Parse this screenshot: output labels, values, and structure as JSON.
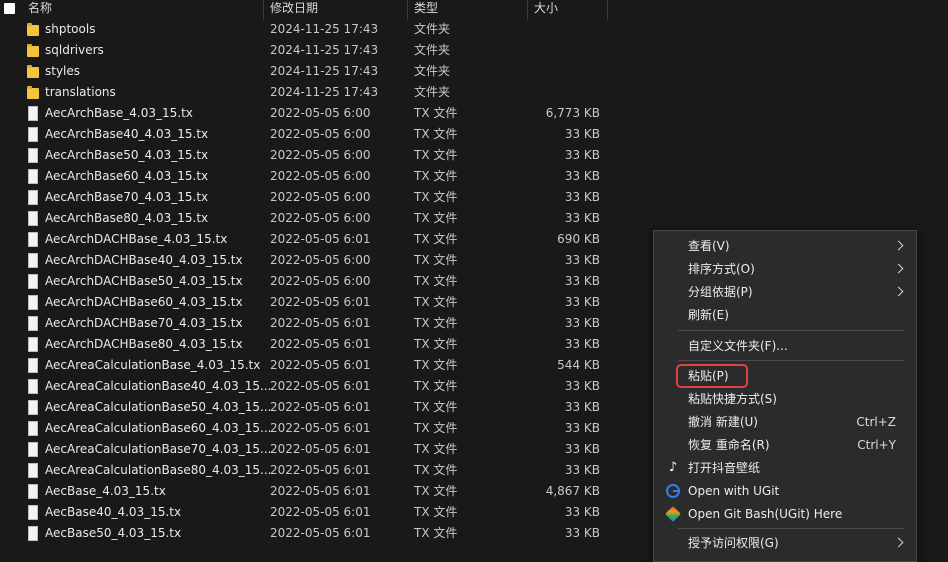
{
  "header": {
    "name_col": "名称",
    "date_col": "修改日期",
    "type_col": "类型",
    "size_col": "大小"
  },
  "rows": [
    {
      "name": "shptools",
      "date": "2024-11-25 17:43",
      "type": "文件夹",
      "size": "",
      "icon": "folder-icon"
    },
    {
      "name": "sqldrivers",
      "date": "2024-11-25 17:43",
      "type": "文件夹",
      "size": "",
      "icon": "folder-icon"
    },
    {
      "name": "styles",
      "date": "2024-11-25 17:43",
      "type": "文件夹",
      "size": "",
      "icon": "folder-icon"
    },
    {
      "name": "translations",
      "date": "2024-11-25 17:43",
      "type": "文件夹",
      "size": "",
      "icon": "folder-icon"
    },
    {
      "name": "AecArchBase_4.03_15.tx",
      "date": "2022-05-05 6:00",
      "type": "TX 文件",
      "size": "6,773 KB",
      "icon": "file-icon"
    },
    {
      "name": "AecArchBase40_4.03_15.tx",
      "date": "2022-05-05 6:00",
      "type": "TX 文件",
      "size": "33 KB",
      "icon": "file-icon"
    },
    {
      "name": "AecArchBase50_4.03_15.tx",
      "date": "2022-05-05 6:00",
      "type": "TX 文件",
      "size": "33 KB",
      "icon": "file-icon"
    },
    {
      "name": "AecArchBase60_4.03_15.tx",
      "date": "2022-05-05 6:00",
      "type": "TX 文件",
      "size": "33 KB",
      "icon": "file-icon"
    },
    {
      "name": "AecArchBase70_4.03_15.tx",
      "date": "2022-05-05 6:00",
      "type": "TX 文件",
      "size": "33 KB",
      "icon": "file-icon"
    },
    {
      "name": "AecArchBase80_4.03_15.tx",
      "date": "2022-05-05 6:00",
      "type": "TX 文件",
      "size": "33 KB",
      "icon": "file-icon"
    },
    {
      "name": "AecArchDACHBase_4.03_15.tx",
      "date": "2022-05-05 6:01",
      "type": "TX 文件",
      "size": "690 KB",
      "icon": "file-icon"
    },
    {
      "name": "AecArchDACHBase40_4.03_15.tx",
      "date": "2022-05-05 6:00",
      "type": "TX 文件",
      "size": "33 KB",
      "icon": "file-icon"
    },
    {
      "name": "AecArchDACHBase50_4.03_15.tx",
      "date": "2022-05-05 6:00",
      "type": "TX 文件",
      "size": "33 KB",
      "icon": "file-icon"
    },
    {
      "name": "AecArchDACHBase60_4.03_15.tx",
      "date": "2022-05-05 6:01",
      "type": "TX 文件",
      "size": "33 KB",
      "icon": "file-icon"
    },
    {
      "name": "AecArchDACHBase70_4.03_15.tx",
      "date": "2022-05-05 6:01",
      "type": "TX 文件",
      "size": "33 KB",
      "icon": "file-icon"
    },
    {
      "name": "AecArchDACHBase80_4.03_15.tx",
      "date": "2022-05-05 6:01",
      "type": "TX 文件",
      "size": "33 KB",
      "icon": "file-icon"
    },
    {
      "name": "AecAreaCalculationBase_4.03_15.tx",
      "date": "2022-05-05 6:01",
      "type": "TX 文件",
      "size": "544 KB",
      "icon": "file-icon"
    },
    {
      "name": "AecAreaCalculationBase40_4.03_15...",
      "date": "2022-05-05 6:01",
      "type": "TX 文件",
      "size": "33 KB",
      "icon": "file-icon"
    },
    {
      "name": "AecAreaCalculationBase50_4.03_15...",
      "date": "2022-05-05 6:01",
      "type": "TX 文件",
      "size": "33 KB",
      "icon": "file-icon"
    },
    {
      "name": "AecAreaCalculationBase60_4.03_15...",
      "date": "2022-05-05 6:01",
      "type": "TX 文件",
      "size": "33 KB",
      "icon": "file-icon"
    },
    {
      "name": "AecAreaCalculationBase70_4.03_15...",
      "date": "2022-05-05 6:01",
      "type": "TX 文件",
      "size": "33 KB",
      "icon": "file-icon"
    },
    {
      "name": "AecAreaCalculationBase80_4.03_15...",
      "date": "2022-05-05 6:01",
      "type": "TX 文件",
      "size": "33 KB",
      "icon": "file-icon"
    },
    {
      "name": "AecBase_4.03_15.tx",
      "date": "2022-05-05 6:01",
      "type": "TX 文件",
      "size": "4,867 KB",
      "icon": "file-icon"
    },
    {
      "name": "AecBase40_4.03_15.tx",
      "date": "2022-05-05 6:01",
      "type": "TX 文件",
      "size": "33 KB",
      "icon": "file-icon"
    },
    {
      "name": "AecBase50_4.03_15.tx",
      "date": "2022-05-05 6:01",
      "type": "TX 文件",
      "size": "33 KB",
      "icon": "file-icon"
    }
  ],
  "context_menu": {
    "items": [
      {
        "label": "查看(V)",
        "shortcut": "",
        "submenu": true,
        "icon": ""
      },
      {
        "label": "排序方式(O)",
        "shortcut": "",
        "submenu": true,
        "icon": ""
      },
      {
        "label": "分组依据(P)",
        "shortcut": "",
        "submenu": true,
        "icon": ""
      },
      {
        "label": "刷新(E)",
        "shortcut": "",
        "submenu": false,
        "icon": ""
      },
      {
        "label": "自定义文件夹(F)...",
        "shortcut": "",
        "submenu": false,
        "icon": ""
      },
      {
        "label": "粘贴(P)",
        "shortcut": "",
        "submenu": false,
        "icon": ""
      },
      {
        "label": "粘贴快捷方式(S)",
        "shortcut": "",
        "submenu": false,
        "icon": ""
      },
      {
        "label": "撤消 新建(U)",
        "shortcut": "Ctrl+Z",
        "submenu": false,
        "icon": ""
      },
      {
        "label": "恢复 重命名(R)",
        "shortcut": "Ctrl+Y",
        "submenu": false,
        "icon": ""
      },
      {
        "label": "打开抖音壁纸",
        "shortcut": "",
        "submenu": false,
        "icon": "tiktok-icon"
      },
      {
        "label": "Open with UGit",
        "shortcut": "",
        "submenu": false,
        "icon": "ugit-icon"
      },
      {
        "label": "Open Git Bash(UGit) Here",
        "shortcut": "",
        "submenu": false,
        "icon": "gitbash-icon"
      },
      {
        "label": "授予访问权限(G)",
        "shortcut": "",
        "submenu": true,
        "icon": ""
      }
    ],
    "highlighted_label": "粘贴(P)",
    "highlight_color": "#e0433f"
  }
}
